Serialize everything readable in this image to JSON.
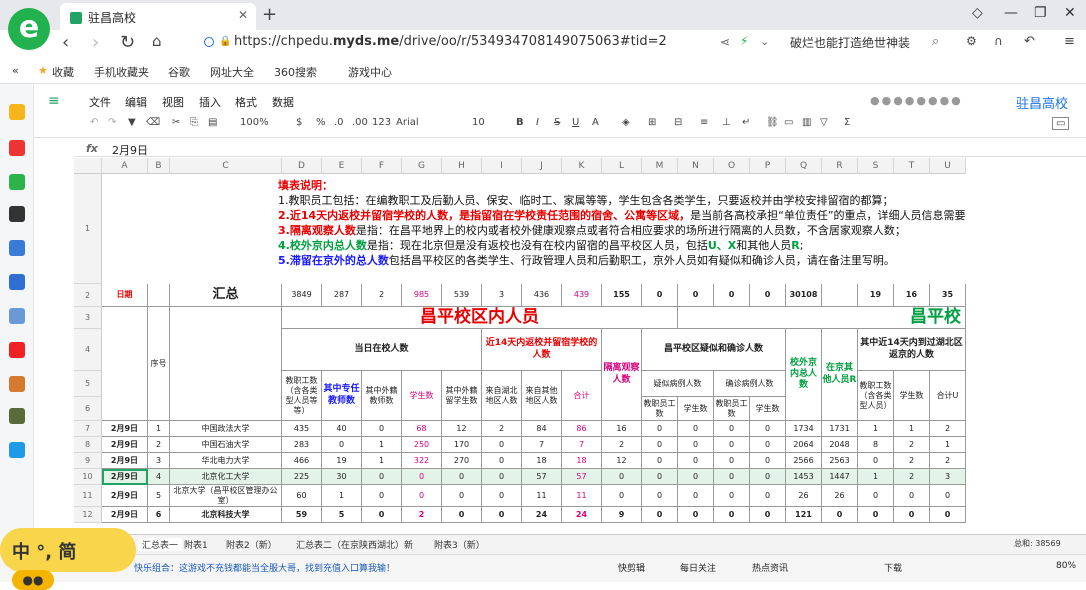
{
  "browser": {
    "tab_title": "驻昌高校",
    "url_prefix": "https://chpedu.",
    "url_domain": "myds.me",
    "url_path": "/drive/oo/r/534934708149075063#tid=2",
    "hot_text": "破烂也能打造绝世神装"
  },
  "bookmarks": [
    "收藏",
    "手机收藏夹",
    "谷歌",
    "网址大全",
    "360搜索",
    "游戏中心"
  ],
  "menus": [
    "文件",
    "编辑",
    "视图",
    "插入",
    "格式",
    "数据"
  ],
  "app_title": "驻昌高校",
  "toolbar": {
    "zoom": "100%",
    "font": "Arial",
    "size": "10"
  },
  "formula": {
    "label": "fx",
    "value": "2月9日"
  },
  "columns": [
    "A",
    "B",
    "C",
    "D",
    "E",
    "F",
    "G",
    "H",
    "I",
    "J",
    "K",
    "L",
    "M",
    "N",
    "O",
    "P",
    "Q",
    "R",
    "S",
    "T",
    "U"
  ],
  "rows": [
    "1",
    "2",
    "3",
    "4",
    "5",
    "6",
    "7",
    "8",
    "9",
    "10",
    "11",
    "12"
  ],
  "note": {
    "title": "填表说明：",
    "l1": "1.教职员工包括：在编教职工及后勤人员、保安、临时工、家属等等，学生包含各类学生，只要返校并由学校安排留宿的都算；",
    "l2a": "2.近14天内返校并留宿学校的人数，是指留宿在学校责任范围的宿舍、公寓等区域，",
    "l2b": "是当前各高校承担“单位责任”的重点，详细人员信息需要",
    "l3a": "3.隔离观察人数",
    "l3b": "是指：在昌平地界上的校内或者校外健康观察点或者符合相应要求的场所进行隔离的人员数，不含居家观察人数；",
    "l4a": "4.校外京内总人数",
    "l4b": "是指：现在北京但是没有返校也没有在校内留宿的昌平校区人员，包括",
    "l4c": "U、X",
    "l4d": "和其他人员",
    "l4e": "R",
    "l4f": ";",
    "l5a": "5.滞留在京外的总人数",
    "l5b": "包括昌平校区的各类学生、行政管理人员和后勤职工，京外人员如有疑似和确诊人员，请在备注里写明。"
  },
  "summary": {
    "label_date": "日期",
    "label_total": "汇总",
    "vals": [
      "3849",
      "287",
      "2",
      "985",
      "539",
      "3",
      "436",
      "439",
      "155",
      "0",
      "0",
      "0",
      "0",
      "30108",
      "",
      "19",
      "16",
      "35"
    ]
  },
  "headers": {
    "seq": "序号",
    "campus_in": "昌平校区内人员",
    "campus_out": "昌平校",
    "present": "当日在校人数",
    "return14": "近14天内返校并留宿学校的人数",
    "isolate": "隔离观察人数",
    "suspect": "昌平校区疑似和确诊人数",
    "outside_bj": "校外京内总人数",
    "other_bj": "在京其他人员R",
    "return_bj": "其中近14天内到过湖北区返京的人数",
    "staff": "教职工数（含各类型人员等等）",
    "fulltime": "其中专任教师数",
    "foreign_staff": "其中外籍教师数",
    "students": "学生数",
    "foreign_students": "其中外籍留学生数",
    "from_hubei": "来自湖北地区人数",
    "from_other": "来自其他地区人数",
    "subtotal": "合计",
    "suspect_cases": "疑似病例人数",
    "confirm_cases": "确诊病例人数",
    "suspect_staff": "教职员工数",
    "suspect_stu": "学生数",
    "confirm_staff": "教职员工数",
    "confirm_stu": "学生数",
    "rb_staff": "教职工数（含各类型人员）",
    "rb_stu": "学生数",
    "rb_total": "合计U"
  },
  "data_rows": [
    {
      "date": "2月9日",
      "seq": "1",
      "name": "中国政法大学",
      "v": [
        "435",
        "40",
        "0",
        "68",
        "12",
        "2",
        "84",
        "86",
        "16",
        "0",
        "0",
        "0",
        "0",
        "1734",
        "1731",
        "1",
        "1",
        "2"
      ]
    },
    {
      "date": "2月9日",
      "seq": "2",
      "name": "中国石油大学",
      "v": [
        "283",
        "0",
        "1",
        "250",
        "170",
        "0",
        "7",
        "7",
        "2",
        "0",
        "0",
        "0",
        "0",
        "2064",
        "2048",
        "8",
        "2",
        "1"
      ]
    },
    {
      "date": "2月9日",
      "seq": "3",
      "name": "华北电力大学",
      "v": [
        "466",
        "19",
        "1",
        "322",
        "270",
        "0",
        "18",
        "18",
        "12",
        "0",
        "0",
        "0",
        "0",
        "2566",
        "2563",
        "0",
        "2",
        "2"
      ]
    },
    {
      "date": "2月9日",
      "seq": "4",
      "name": "北京化工大学",
      "v": [
        "225",
        "30",
        "0",
        "0",
        "0",
        "0",
        "57",
        "57",
        "0",
        "0",
        "0",
        "0",
        "0",
        "1453",
        "1447",
        "1",
        "2",
        "3"
      ]
    },
    {
      "date": "2月9日",
      "seq": "5",
      "name": "北京大学（昌平校区管理办公室）",
      "v": [
        "60",
        "1",
        "0",
        "0",
        "0",
        "0",
        "11",
        "11",
        "0",
        "0",
        "0",
        "0",
        "0",
        "26",
        "26",
        "0",
        "0",
        "0"
      ]
    },
    {
      "date": "2月9日",
      "seq": "6",
      "name": "北京科技大学",
      "v": [
        "59",
        "5",
        "0",
        "2",
        "0",
        "0",
        "24",
        "24",
        "9",
        "0",
        "0",
        "0",
        "0",
        "121",
        "0",
        "0",
        "0",
        "0"
      ]
    }
  ],
  "sheet_tabs": [
    "汇总表一",
    "附表1",
    "附表2（新）",
    "汇总表二（在京陕西湖北）新",
    "附表3（新）"
  ],
  "sheet_count": "总和: 38569",
  "status": {
    "ticker": "快乐组合：这游戏不充钱都能当全服大哥，找到充值入口算我输！",
    "items": [
      "快剪辑",
      "每日关注",
      "热点资讯",
      "下载"
    ],
    "zoom": "80%"
  },
  "ime": {
    "text": "中 °, 简"
  },
  "colors": {
    "accent": "#1a73e8",
    "red": "#e60000",
    "pink": "#d9007e",
    "green": "#00a040",
    "blue": "#1a1aff"
  }
}
